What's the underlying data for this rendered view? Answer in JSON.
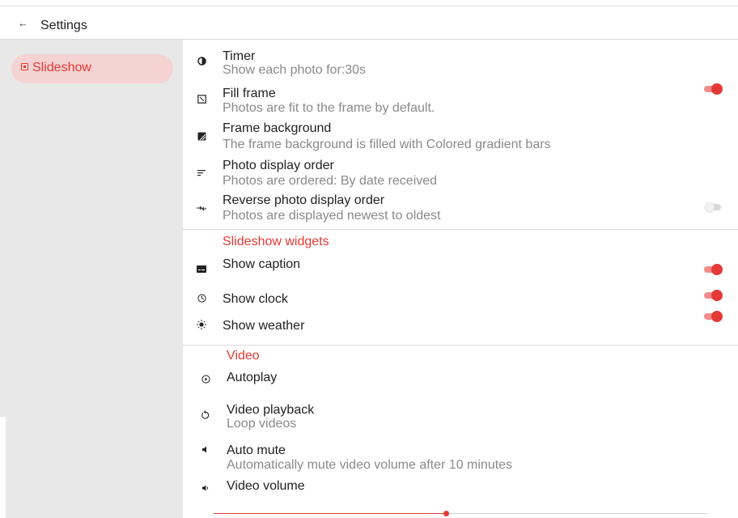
{
  "header": {
    "back_icon": "←",
    "title": "Settings"
  },
  "sidebar": {
    "items": [
      {
        "label": "Slideshow",
        "icon": "slideshow-icon",
        "selected": true
      }
    ]
  },
  "slideshow": {
    "timer": {
      "title": "Timer",
      "subtitle": "Show each photo for:30s",
      "icon": "timer-icon"
    },
    "fill_frame": {
      "title": "Fill frame",
      "subtitle": "Photos are fit to the frame by default.",
      "icon": "crop-icon",
      "enabled": true
    },
    "frame_background": {
      "title": "Frame background",
      "subtitle": "The frame background is filled with Colored gradient bars",
      "icon": "gradient-icon"
    },
    "display_order": {
      "title": "Photo display order",
      "subtitle": "Photos are ordered: By date received",
      "icon": "sort-icon"
    },
    "reverse_order": {
      "title": "Reverse photo display order",
      "subtitle": "Photos are displayed newest to oldest",
      "icon": "swap-icon",
      "enabled": false
    }
  },
  "widgets": {
    "heading": "Slideshow widgets",
    "caption": {
      "title": "Show caption",
      "icon": "caption-icon",
      "enabled": true
    },
    "clock": {
      "title": "Show clock",
      "icon": "clock-icon",
      "enabled": true
    },
    "weather": {
      "title": "Show weather",
      "icon": "sun-icon",
      "enabled": true
    }
  },
  "video": {
    "heading": "Video",
    "autoplay": {
      "title": "Autoplay",
      "icon": "play-circle-icon"
    },
    "playback": {
      "title": "Video playback",
      "subtitle": "Loop videos",
      "icon": "replay-icon"
    },
    "auto_mute": {
      "title": "Auto mute",
      "subtitle": "Automatically mute video volume after 10 minutes",
      "icon": "volume-mute-icon"
    },
    "volume": {
      "title": "Video volume",
      "icon": "volume-icon",
      "level": 0.47
    }
  },
  "colors": {
    "accent": "#e53935",
    "selected_bg": "#f5d3d3",
    "sidebar_bg": "#e8e8e8",
    "subtitle": "#8a8a8a"
  }
}
